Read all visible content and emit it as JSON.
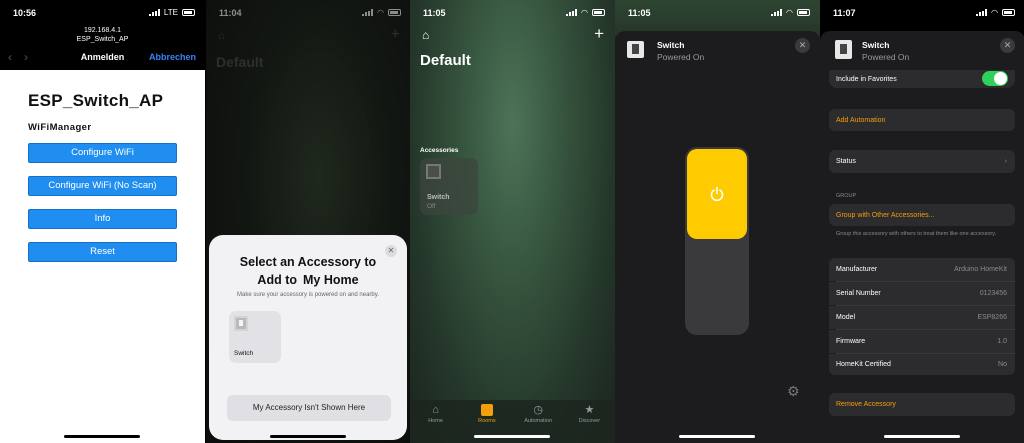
{
  "phone1": {
    "time": "10:56",
    "carrier": "LTE",
    "url_ip": "192.168.4.1",
    "url_name": "ESP_Switch_AP",
    "nav_title": "Anmelden",
    "nav_cancel": "Abbrechen",
    "heading": "ESP_Switch_AP",
    "subheading": "WiFiManager",
    "buttons": [
      "Configure WiFi",
      "Configure WiFi (No Scan)",
      "Info",
      "Reset"
    ]
  },
  "phone2": {
    "time": "11:04",
    "bg_title": "Default",
    "sheet_title_1": "Select an Accessory to",
    "sheet_title_2a": "Add to",
    "sheet_title_2b": "My Home",
    "sheet_subtitle": "Make sure your accessory is powered on and nearby.",
    "tile_name": "Switch",
    "not_shown_button": "My Accessory Isn't Shown Here"
  },
  "phone3": {
    "time": "11:05",
    "title": "Default",
    "section": "Accessories",
    "accessory_name": "Switch",
    "accessory_state": "Off",
    "tabs": [
      {
        "label": "Home",
        "icon": "house-icon"
      },
      {
        "label": "Rooms",
        "icon": "rooms-icon",
        "active": true
      },
      {
        "label": "Automation",
        "icon": "clock-check-icon"
      },
      {
        "label": "Discover",
        "icon": "star-icon"
      }
    ]
  },
  "phone4": {
    "time": "11:05",
    "name": "Switch",
    "status": "Powered On",
    "accent": "#fdcb00"
  },
  "phone5": {
    "time": "11:07",
    "name": "Switch",
    "status": "Powered On",
    "favorites_label": "Include in Favorites",
    "add_automation": "Add Automation",
    "status_row": "Status",
    "group_header": "GROUP",
    "group_button": "Group with Other Accessories...",
    "group_note": "Group this accessory with others to treat them like one accessory.",
    "info": [
      {
        "label": "Manufacturer",
        "value": "Arduino HomeKit"
      },
      {
        "label": "Serial Number",
        "value": "0123456"
      },
      {
        "label": "Model",
        "value": "ESP8266"
      },
      {
        "label": "Firmware",
        "value": "1.0"
      },
      {
        "label": "HomeKit Certified",
        "value": "No"
      }
    ],
    "remove": "Remove Accessory"
  }
}
